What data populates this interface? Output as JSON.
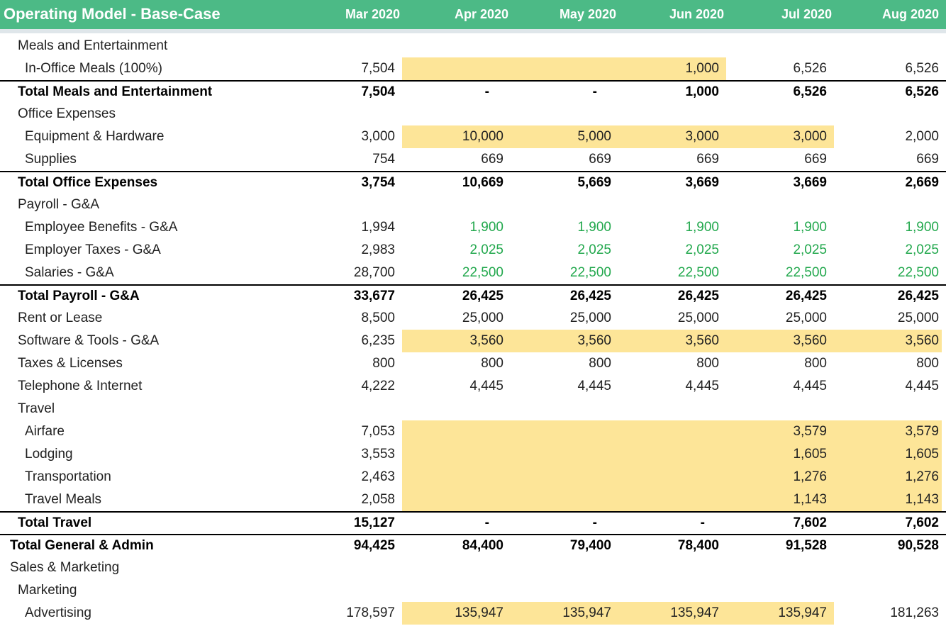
{
  "header": {
    "title": "Operating Model - Base-Case",
    "months": [
      "Mar 2020",
      "Apr 2020",
      "May 2020",
      "Jun 2020",
      "Jul 2020",
      "Aug 2020"
    ]
  },
  "colors": {
    "header_bg": "#4cba86",
    "highlight": "#fde598",
    "formula_green": "#22a84d"
  },
  "rows": [
    {
      "label": "Meals and Entertainment",
      "indent": 1,
      "values": [
        "",
        "",
        "",
        "",
        "",
        ""
      ]
    },
    {
      "label": "In-Office Meals (100%)",
      "indent": 2,
      "values": [
        "7,504",
        "",
        "",
        "1,000",
        "6,526",
        "6,526"
      ],
      "highlight": [
        1,
        2,
        3
      ]
    },
    {
      "label": "Total Meals and Entertainment",
      "indent": 1,
      "bold": true,
      "border": true,
      "values": [
        "7,504",
        "-",
        "-",
        "1,000",
        "6,526",
        "6,526"
      ]
    },
    {
      "label": "Office Expenses",
      "indent": 1,
      "values": [
        "",
        "",
        "",
        "",
        "",
        ""
      ]
    },
    {
      "label": "Equipment & Hardware",
      "indent": 2,
      "values": [
        "3,000",
        "10,000",
        "5,000",
        "3,000",
        "3,000",
        "2,000"
      ],
      "highlight": [
        1,
        2,
        3,
        4
      ]
    },
    {
      "label": "Supplies",
      "indent": 2,
      "values": [
        "754",
        "669",
        "669",
        "669",
        "669",
        "669"
      ]
    },
    {
      "label": "Total Office Expenses",
      "indent": 1,
      "bold": true,
      "border": true,
      "values": [
        "3,754",
        "10,669",
        "5,669",
        "3,669",
        "3,669",
        "2,669"
      ]
    },
    {
      "label": "Payroll - G&A",
      "indent": 1,
      "values": [
        "",
        "",
        "",
        "",
        "",
        ""
      ]
    },
    {
      "label": "Employee Benefits - G&A",
      "indent": 2,
      "values": [
        "1,994",
        "1,900",
        "1,900",
        "1,900",
        "1,900",
        "1,900"
      ],
      "green": true
    },
    {
      "label": "Employer Taxes - G&A",
      "indent": 2,
      "values": [
        "2,983",
        "2,025",
        "2,025",
        "2,025",
        "2,025",
        "2,025"
      ],
      "green": true
    },
    {
      "label": "Salaries - G&A",
      "indent": 2,
      "values": [
        "28,700",
        "22,500",
        "22,500",
        "22,500",
        "22,500",
        "22,500"
      ],
      "green": true
    },
    {
      "label": "Total Payroll - G&A",
      "indent": 1,
      "bold": true,
      "border": true,
      "values": [
        "33,677",
        "26,425",
        "26,425",
        "26,425",
        "26,425",
        "26,425"
      ]
    },
    {
      "label": "Rent or Lease",
      "indent": 1,
      "values": [
        "8,500",
        "25,000",
        "25,000",
        "25,000",
        "25,000",
        "25,000"
      ]
    },
    {
      "label": "Software & Tools - G&A",
      "indent": 1,
      "values": [
        "6,235",
        "3,560",
        "3,560",
        "3,560",
        "3,560",
        "3,560"
      ],
      "highlight": [
        1,
        2,
        3,
        4,
        5
      ]
    },
    {
      "label": "Taxes & Licenses",
      "indent": 1,
      "values": [
        "800",
        "800",
        "800",
        "800",
        "800",
        "800"
      ]
    },
    {
      "label": "Telephone & Internet",
      "indent": 1,
      "values": [
        "4,222",
        "4,445",
        "4,445",
        "4,445",
        "4,445",
        "4,445"
      ]
    },
    {
      "label": "Travel",
      "indent": 1,
      "values": [
        "",
        "",
        "",
        "",
        "",
        ""
      ]
    },
    {
      "label": "Airfare",
      "indent": 2,
      "values": [
        "7,053",
        "",
        "",
        "",
        "3,579",
        "3,579"
      ],
      "highlight": [
        1,
        2,
        3,
        4,
        5
      ]
    },
    {
      "label": "Lodging",
      "indent": 2,
      "values": [
        "3,553",
        "",
        "",
        "",
        "1,605",
        "1,605"
      ],
      "highlight": [
        1,
        2,
        3,
        4,
        5
      ]
    },
    {
      "label": "Transportation",
      "indent": 2,
      "values": [
        "2,463",
        "",
        "",
        "",
        "1,276",
        "1,276"
      ],
      "highlight": [
        1,
        2,
        3,
        4,
        5
      ]
    },
    {
      "label": "Travel Meals",
      "indent": 2,
      "values": [
        "2,058",
        "",
        "",
        "",
        "1,143",
        "1,143"
      ],
      "highlight": [
        1,
        2,
        3,
        4,
        5
      ]
    },
    {
      "label": "Total Travel",
      "indent": 1,
      "bold": true,
      "border": true,
      "values": [
        "15,127",
        "-",
        "-",
        "-",
        "7,602",
        "7,602"
      ]
    },
    {
      "label": "Total General & Admin",
      "indent": 0,
      "bold": true,
      "border": true,
      "values": [
        "94,425",
        "84,400",
        "79,400",
        "78,400",
        "91,528",
        "90,528"
      ]
    },
    {
      "label": "Sales & Marketing",
      "indent": 0,
      "values": [
        "",
        "",
        "",
        "",
        "",
        ""
      ]
    },
    {
      "label": "Marketing",
      "indent": 1,
      "values": [
        "",
        "",
        "",
        "",
        "",
        ""
      ]
    },
    {
      "label": "Advertising",
      "indent": 2,
      "values": [
        "178,597",
        "135,947",
        "135,947",
        "135,947",
        "135,947",
        "181,263"
      ],
      "highlight": [
        1,
        2,
        3,
        4
      ]
    }
  ]
}
